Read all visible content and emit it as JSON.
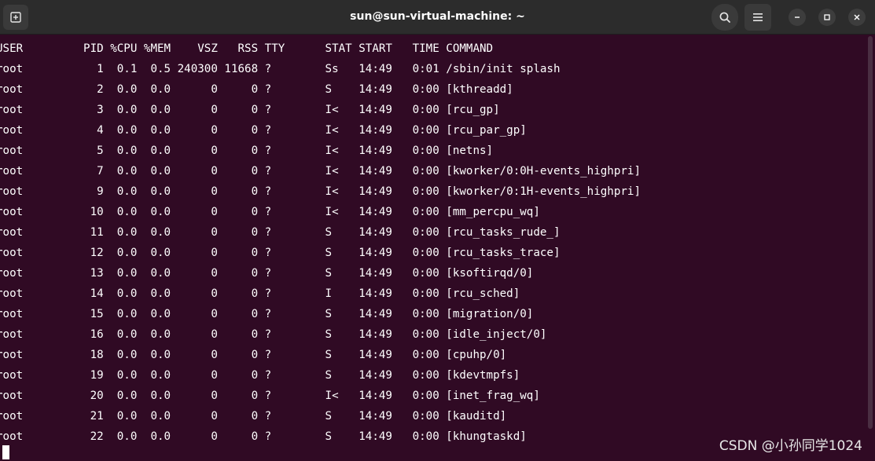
{
  "window": {
    "title": "sun@sun-virtual-machine: ~",
    "icons": {
      "new_tab": "new-tab-icon",
      "search": "search-icon",
      "menu": "hamburger-menu-icon",
      "minimize": "minimize-icon",
      "maximize": "maximize-icon",
      "close": "close-icon"
    }
  },
  "terminal": {
    "colors": {
      "background": "#300a24",
      "foreground": "#ffffff"
    },
    "lines": [
      "USER         PID %CPU %MEM    VSZ   RSS TTY      STAT START   TIME COMMAND",
      "root           1  0.1  0.5 240300 11668 ?        Ss   14:49   0:01 /sbin/init splash",
      "root           2  0.0  0.0      0     0 ?        S    14:49   0:00 [kthreadd]",
      "root           3  0.0  0.0      0     0 ?        I<   14:49   0:00 [rcu_gp]",
      "root           4  0.0  0.0      0     0 ?        I<   14:49   0:00 [rcu_par_gp]",
      "root           5  0.0  0.0      0     0 ?        I<   14:49   0:00 [netns]",
      "root           7  0.0  0.0      0     0 ?        I<   14:49   0:00 [kworker/0:0H-events_highpri]",
      "root           9  0.0  0.0      0     0 ?        I<   14:49   0:00 [kworker/0:1H-events_highpri]",
      "root          10  0.0  0.0      0     0 ?        I<   14:49   0:00 [mm_percpu_wq]",
      "root          11  0.0  0.0      0     0 ?        S    14:49   0:00 [rcu_tasks_rude_]",
      "root          12  0.0  0.0      0     0 ?        S    14:49   0:00 [rcu_tasks_trace]",
      "root          13  0.0  0.0      0     0 ?        S    14:49   0:00 [ksoftirqd/0]",
      "root          14  0.0  0.0      0     0 ?        I    14:49   0:00 [rcu_sched]",
      "root          15  0.0  0.0      0     0 ?        S    14:49   0:00 [migration/0]",
      "root          16  0.0  0.0      0     0 ?        S    14:49   0:00 [idle_inject/0]",
      "root          18  0.0  0.0      0     0 ?        S    14:49   0:00 [cpuhp/0]",
      "root          19  0.0  0.0      0     0 ?        S    14:49   0:00 [kdevtmpfs]",
      "root          20  0.0  0.0      0     0 ?        I<   14:49   0:00 [inet_frag_wq]",
      "root          21  0.0  0.0      0     0 ?        S    14:49   0:00 [kauditd]",
      "root          22  0.0  0.0      0     0 ?        S    14:49   0:00 [khungtaskd]"
    ]
  },
  "watermark": "CSDN @小孙同学1024"
}
